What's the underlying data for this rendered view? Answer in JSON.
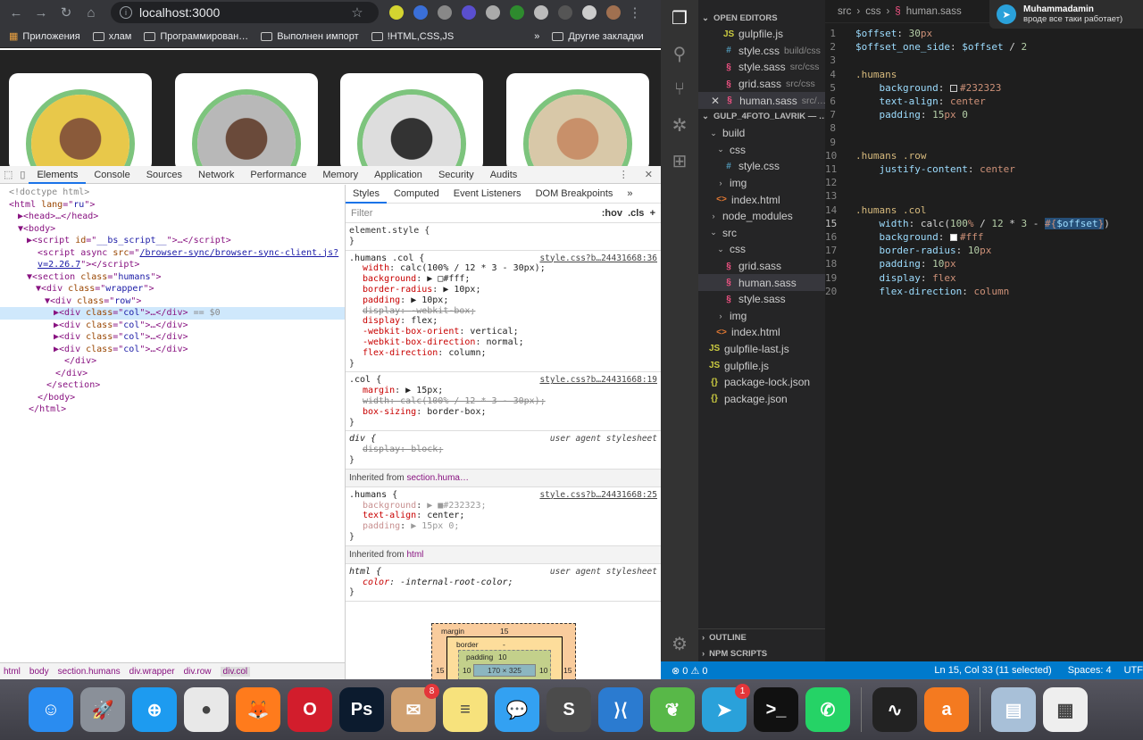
{
  "chrome": {
    "url": "localhost:3000",
    "bookmarks": [
      "Приложения",
      "хлам",
      "Программирован…",
      "Выполнен импорт",
      "!HTML,CSS,JS"
    ],
    "bookmarks_more": "»",
    "other_bookmarks": "Другие закладки"
  },
  "devtools": {
    "tabs": [
      "Elements",
      "Console",
      "Sources",
      "Network",
      "Performance",
      "Memory",
      "Application",
      "Security",
      "Audits"
    ],
    "active_tab": "Elements",
    "dom_lines": [
      {
        "indent": 0,
        "html": "<span class='gray'>&lt;!doctype html&gt;</span>"
      },
      {
        "indent": 0,
        "html": "&lt;html <span class='attr'>lang</span>=\"<span class='val'>ru</span>\"&gt;"
      },
      {
        "indent": 1,
        "html": "▶&lt;head&gt;…&lt;/head&gt;"
      },
      {
        "indent": 1,
        "html": "▼&lt;body&gt;"
      },
      {
        "indent": 2,
        "html": "▶&lt;script <span class='attr'>id</span>=\"<span class='val'>__bs_script__</span>\"&gt;…&lt;/script&gt;"
      },
      {
        "indent": 2,
        "html": "&nbsp;&nbsp;&lt;script async <span class='attr'>src</span>=\"<span class='val' style='text-decoration:underline'>/browser-sync/browser-sync-client.js?</span>"
      },
      {
        "indent": 2,
        "html": "&nbsp;&nbsp;<span class='val' style='text-decoration:underline'>v=2.26.7</span>\"&gt;&lt;/script&gt;"
      },
      {
        "indent": 2,
        "html": "▼&lt;section <span class='attr'>class</span>=\"<span class='val'>humans</span>\"&gt;"
      },
      {
        "indent": 3,
        "html": "▼&lt;div <span class='attr'>class</span>=\"<span class='val'>wrapper</span>\"&gt;"
      },
      {
        "indent": 4,
        "html": "▼&lt;div <span class='attr'>class</span>=\"<span class='val'>row</span>\"&gt;"
      },
      {
        "indent": 5,
        "html": "▶&lt;div <span class='attr'>class</span>=\"<span class='val'>col</span>\"&gt;…&lt;/div&gt; <span class='gray'>== $0</span>",
        "selected": true
      },
      {
        "indent": 5,
        "html": "▶&lt;div <span class='attr'>class</span>=\"<span class='val'>col</span>\"&gt;…&lt;/div&gt;"
      },
      {
        "indent": 5,
        "html": "▶&lt;div <span class='attr'>class</span>=\"<span class='val'>col</span>\"&gt;…&lt;/div&gt;"
      },
      {
        "indent": 5,
        "html": "▶&lt;div <span class='attr'>class</span>=\"<span class='val'>col</span>\"&gt;…&lt;/div&gt;"
      },
      {
        "indent": 5,
        "html": "&nbsp;&nbsp;&lt;/div&gt;"
      },
      {
        "indent": 4,
        "html": "&nbsp;&nbsp;&lt;/div&gt;"
      },
      {
        "indent": 3,
        "html": "&nbsp;&nbsp;&lt;/section&gt;"
      },
      {
        "indent": 2,
        "html": "&nbsp;&nbsp;&lt;/body&gt;"
      },
      {
        "indent": 1,
        "html": "&nbsp;&nbsp;&lt;/html&gt;"
      }
    ],
    "breadcrumbs": [
      "html",
      "body",
      "section.humans",
      "div.wrapper",
      "div.row",
      "div.col"
    ],
    "styles_tabs": [
      "Styles",
      "Computed",
      "Event Listeners",
      "DOM Breakpoints",
      "»"
    ],
    "filter_placeholder": "Filter",
    "filter_hov": ":hov",
    "filter_cls": ".cls",
    "filter_add": "+",
    "element_style": "element.style {",
    "rules": [
      {
        "selector": ".humans .col {",
        "src": "style.css?b…24431668:36",
        "ua": false,
        "props": [
          [
            "width",
            "calc(100% / 12 * 3 - 30px);",
            false
          ],
          [
            "background",
            "▶ □#fff;",
            false
          ],
          [
            "border-radius",
            "▶ 10px;",
            false
          ],
          [
            "padding",
            "▶ 10px;",
            false
          ],
          [
            "display",
            "-webkit-box;",
            true
          ],
          [
            "display",
            "flex;",
            false
          ],
          [
            "-webkit-box-orient",
            "vertical;",
            false
          ],
          [
            "-webkit-box-direction",
            "normal;",
            false
          ],
          [
            "flex-direction",
            "column;",
            false
          ]
        ]
      },
      {
        "selector": ".col {",
        "src": "style.css?b…24431668:19",
        "ua": false,
        "props": [
          [
            "margin",
            "▶ 15px;",
            false
          ],
          [
            "width",
            "calc(100% / 12 * 3 - 30px);",
            true
          ],
          [
            "box-sizing",
            "border-box;",
            false
          ]
        ]
      },
      {
        "selector": "div {",
        "src": "user agent stylesheet",
        "ua": true,
        "props": [
          [
            "display",
            "block;",
            true
          ]
        ]
      }
    ],
    "inherited_1": {
      "label": "Inherited from",
      "target": "section.huma…"
    },
    "rule_humans": {
      "selector": ".humans {",
      "src": "style.css?b…24431668:25",
      "props": [
        [
          "background",
          "▶ ■#232323;"
        ],
        [
          "text-align",
          "center;"
        ],
        [
          "padding",
          "▶ 15px 0;"
        ]
      ]
    },
    "inherited_2": {
      "label": "Inherited from",
      "target": "html"
    },
    "rule_html": {
      "selector": "html {",
      "src": "user agent stylesheet",
      "prop": "color",
      "value": "-internal-root-color;"
    },
    "boxmodel": {
      "margin_label": "margin",
      "margin_top": "15",
      "border_label": "border",
      "border_val": "-",
      "padding_label": "padding",
      "padding_val": "10",
      "content": "170 × 325",
      "left_m": "15",
      "left_p": "10",
      "right_p": "10",
      "right_m": "15"
    }
  },
  "vscode": {
    "open_editors_title": "OPEN EDITORS",
    "open_editors": [
      {
        "icon": "JS",
        "type": "js",
        "name": "gulpfile.js",
        "dir": ""
      },
      {
        "icon": "#",
        "type": "css",
        "name": "style.css",
        "dir": "build/css"
      },
      {
        "icon": "§",
        "type": "sass",
        "name": "style.sass",
        "dir": "src/css"
      },
      {
        "icon": "§",
        "type": "sass",
        "name": "grid.sass",
        "dir": "src/css"
      },
      {
        "icon": "§",
        "type": "sass",
        "name": "human.sass",
        "dir": "src/…",
        "active": true
      }
    ],
    "project_title": "GULP_4FOTO_LAVRIK — …",
    "tree": [
      {
        "lvl": 0,
        "chev": "⌄",
        "icon": "",
        "type": "",
        "name": "build"
      },
      {
        "lvl": 1,
        "chev": "⌄",
        "icon": "",
        "type": "",
        "name": "css"
      },
      {
        "lvl": 2,
        "chev": "",
        "icon": "#",
        "type": "css",
        "name": "style.css"
      },
      {
        "lvl": 1,
        "chev": "›",
        "icon": "",
        "type": "",
        "name": "img"
      },
      {
        "lvl": 1,
        "chev": "",
        "icon": "<>",
        "type": "html",
        "name": "index.html"
      },
      {
        "lvl": 0,
        "chev": "›",
        "icon": "",
        "type": "",
        "name": "node_modules"
      },
      {
        "lvl": 0,
        "chev": "⌄",
        "icon": "",
        "type": "",
        "name": "src"
      },
      {
        "lvl": 1,
        "chev": "⌄",
        "icon": "",
        "type": "",
        "name": "css"
      },
      {
        "lvl": 2,
        "chev": "",
        "icon": "§",
        "type": "sass",
        "name": "grid.sass"
      },
      {
        "lvl": 2,
        "chev": "",
        "icon": "§",
        "type": "sass",
        "name": "human.sass",
        "active": true
      },
      {
        "lvl": 2,
        "chev": "",
        "icon": "§",
        "type": "sass",
        "name": "style.sass"
      },
      {
        "lvl": 1,
        "chev": "›",
        "icon": "",
        "type": "",
        "name": "img"
      },
      {
        "lvl": 1,
        "chev": "",
        "icon": "<>",
        "type": "html",
        "name": "index.html"
      },
      {
        "lvl": 0,
        "chev": "",
        "icon": "JS",
        "type": "js",
        "name": "gulpfile-last.js"
      },
      {
        "lvl": 0,
        "chev": "",
        "icon": "JS",
        "type": "js",
        "name": "gulpfile.js"
      },
      {
        "lvl": 0,
        "chev": "",
        "icon": "{}",
        "type": "json",
        "name": "package-lock.json"
      },
      {
        "lvl": 0,
        "chev": "",
        "icon": "{}",
        "type": "json",
        "name": "package.json"
      }
    ],
    "outline": "OUTLINE",
    "npm": "NPM SCRIPTS",
    "editor_crumbs": [
      "src",
      "css",
      "human.sass"
    ],
    "code": [
      "<span class='k'>$offset</span><span class='pl'>: </span><span class='n'>30</span><span class='v'>px</span>",
      "<span class='k'>$offset_one_side</span><span class='pl'>: </span><span class='k'>$offset</span><span class='pl'> / </span><span class='n'>2</span>",
      "",
      "<span class='sel1'>.humans</span>",
      "&nbsp;&nbsp;&nbsp;&nbsp;<span class='k'>background</span><span class='pl'>: </span><span class='swatch' style='background:#232323'></span><span class='v'>#232323</span>",
      "&nbsp;&nbsp;&nbsp;&nbsp;<span class='k'>text-align</span><span class='pl'>: </span><span class='v'>center</span>",
      "&nbsp;&nbsp;&nbsp;&nbsp;<span class='k'>padding</span><span class='pl'>: </span><span class='n'>15</span><span class='v'>px</span><span class='pl'> </span><span class='n'>0</span>",
      "",
      "",
      "<span class='sel1'>.humans .row</span>",
      "&nbsp;&nbsp;&nbsp;&nbsp;<span class='k'>justify-content</span><span class='pl'>: </span><span class='v'>center</span>",
      "",
      "",
      "<span class='sel1'>.humans .col</span>",
      "&nbsp;&nbsp;&nbsp;&nbsp;<span class='k'>width</span><span class='pl'>: calc(</span><span class='n'>100</span><span class='v'>%</span><span class='pl'> / </span><span class='n'>12</span><span class='pl'> * </span><span class='n'>3</span><span class='pl'> - </span><span class='hl'><span class='v'>#{</span><span class='k'>$offset</span><span class='v'>}</span></span><span class='pl'>)</span>",
      "&nbsp;&nbsp;&nbsp;&nbsp;<span class='k'>background</span><span class='pl'>: </span><span class='swatch' style='background:#fff'></span><span class='v'>#fff</span>",
      "&nbsp;&nbsp;&nbsp;&nbsp;<span class='k'>border-radius</span><span class='pl'>: </span><span class='n'>10</span><span class='v'>px</span>",
      "&nbsp;&nbsp;&nbsp;&nbsp;<span class='k'>padding</span><span class='pl'>: </span><span class='n'>10</span><span class='v'>px</span>",
      "&nbsp;&nbsp;&nbsp;&nbsp;<span class='k'>display</span><span class='pl'>: </span><span class='v'>flex</span>",
      "&nbsp;&nbsp;&nbsp;&nbsp;<span class='k'>flex-direction</span><span class='pl'>: </span><span class='v'>column</span>"
    ],
    "current_line": 15,
    "status": {
      "problems": "⊗ 0 ⚠ 0",
      "position": "Ln 15, Col 33 (11 selected)",
      "spaces": "Spaces: 4",
      "encoding": "UTF"
    }
  },
  "notification": {
    "name": "Muhammadamin",
    "text": "вроде все таки работает)"
  },
  "dock": {
    "apps": [
      {
        "name": "Finder",
        "bg": "#2a8cf0",
        "glyph": "☺"
      },
      {
        "name": "Launchpad",
        "bg": "#8a9099",
        "glyph": "🚀"
      },
      {
        "name": "Safari",
        "bg": "#1d9bf0",
        "glyph": "⊕"
      },
      {
        "name": "Chrome",
        "bg": "#e8e8e8",
        "glyph": "●"
      },
      {
        "name": "Firefox",
        "bg": "#ff7b1c",
        "glyph": "🦊"
      },
      {
        "name": "Opera",
        "bg": "#d21d2c",
        "glyph": "O"
      },
      {
        "name": "Photoshop",
        "bg": "#0c1b2e",
        "glyph": "Ps"
      },
      {
        "name": "Mail",
        "bg": "#d0a070",
        "glyph": "✉",
        "badge": "8"
      },
      {
        "name": "Notes",
        "bg": "#f7e27c",
        "glyph": "≡"
      },
      {
        "name": "Messages",
        "bg": "#33a1f2",
        "glyph": "💬"
      },
      {
        "name": "Sublime Text",
        "bg": "#4b4b4b",
        "glyph": "S"
      },
      {
        "name": "VS Code",
        "bg": "#2b7bd0",
        "glyph": "⟩⟨"
      },
      {
        "name": "Leaf",
        "bg": "#58b848",
        "glyph": "❦"
      },
      {
        "name": "Telegram",
        "bg": "#2aa1da",
        "glyph": "➤",
        "badge": "1"
      },
      {
        "name": "Terminal",
        "bg": "#111",
        "glyph": ">_"
      },
      {
        "name": "WhatsApp",
        "bg": "#25d366",
        "glyph": "✆"
      },
      {
        "name": "Activity Monitor",
        "bg": "#222",
        "glyph": "∿"
      },
      {
        "name": "Avast",
        "bg": "#f47a20",
        "glyph": "a"
      },
      {
        "name": "Preview",
        "bg": "#a8c0d8",
        "glyph": "▤"
      },
      {
        "name": "Screenshot",
        "bg": "#eee",
        "glyph": "▦"
      }
    ]
  }
}
